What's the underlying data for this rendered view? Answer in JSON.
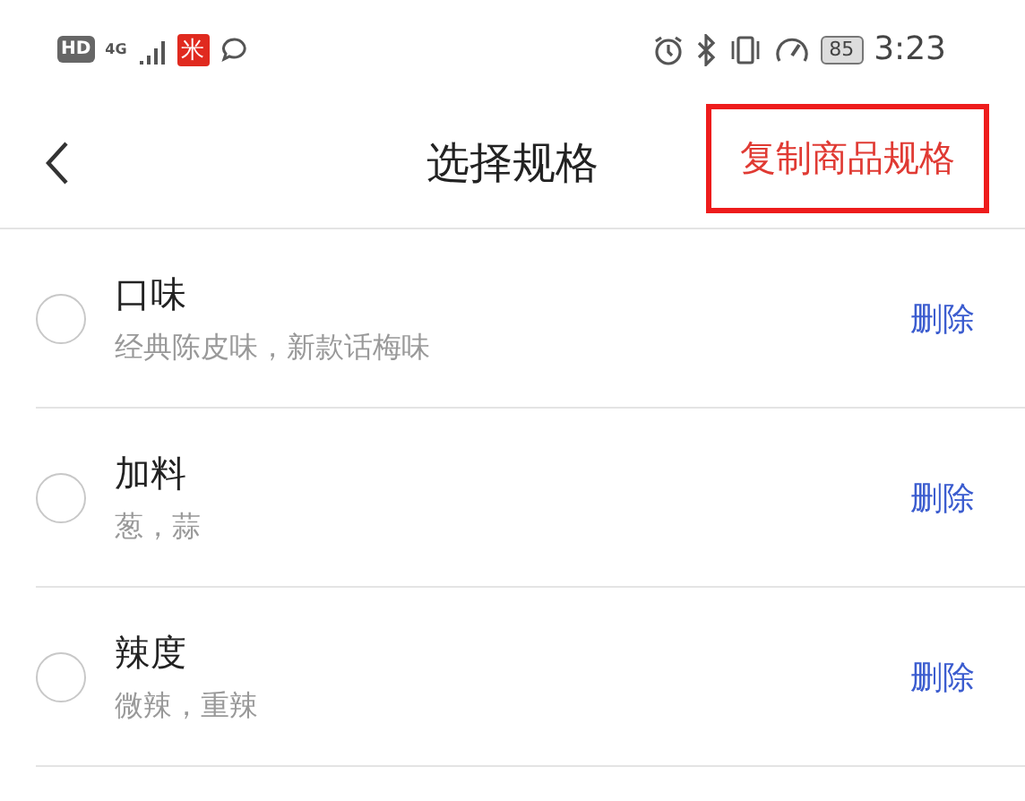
{
  "status_bar": {
    "hd": "HD",
    "network": "4G",
    "app_badge": "米",
    "battery": "85",
    "time": "3:23"
  },
  "header": {
    "title": "选择规格",
    "action": {
      "label": "复制商品规格",
      "highlighted": true
    }
  },
  "specs": [
    {
      "name": "口味",
      "options": "经典陈皮味，新款话梅味",
      "selected": false,
      "action": "删除"
    },
    {
      "name": "加料",
      "options": "葱，蒜",
      "selected": false,
      "action": "删除"
    },
    {
      "name": "辣度",
      "options": "微辣，重辣",
      "selected": false,
      "action": "删除"
    }
  ]
}
